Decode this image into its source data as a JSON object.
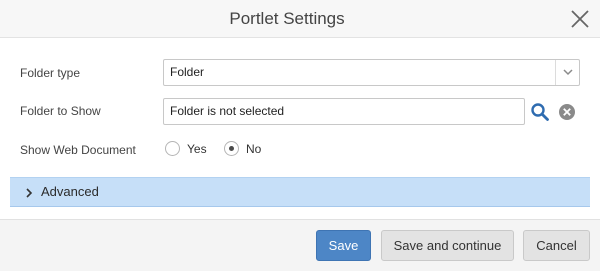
{
  "dialog": {
    "title": "Portlet Settings",
    "close_icon": "close-icon"
  },
  "form": {
    "folder_type": {
      "label": "Folder type",
      "value": "Folder",
      "arrow_icon": "chevron-down-icon"
    },
    "folder_to_show": {
      "label": "Folder to Show",
      "value": "Folder is not selected",
      "search_icon": "search-icon",
      "clear_icon": "clear-icon"
    },
    "show_web_document": {
      "label": "Show Web Document",
      "options": [
        {
          "label": "Yes",
          "selected": false
        },
        {
          "label": "No",
          "selected": true
        }
      ]
    }
  },
  "advanced": {
    "label": "Advanced",
    "expanded": false,
    "icon": "chevron-right-icon"
  },
  "footer": {
    "save_label": "Save",
    "save_continue_label": "Save and continue",
    "cancel_label": "Cancel"
  },
  "colors": {
    "primary": "#4d86c6",
    "advanced_bg": "#c6dff8",
    "search_icon": "#2f6cb0",
    "clear_icon": "#8a8a8a"
  }
}
